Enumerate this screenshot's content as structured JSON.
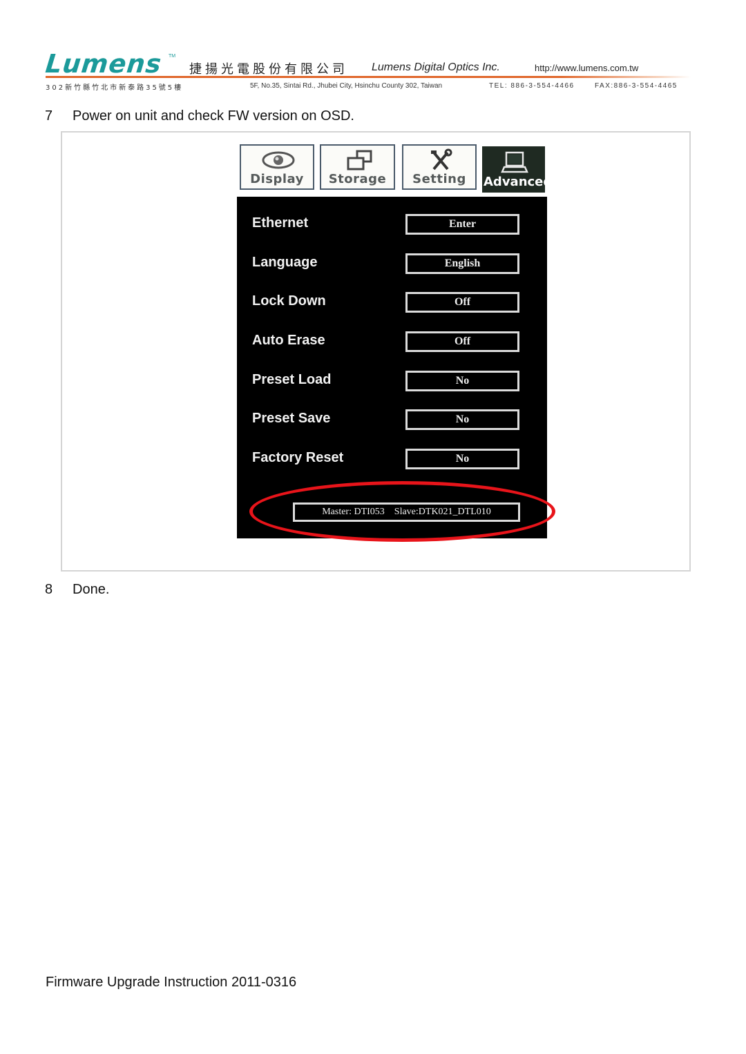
{
  "letterhead": {
    "logo_text": "Lumens",
    "trademark": "TM",
    "company_name_cn": "捷揚光電股份有限公司",
    "company_name_en": "Lumens Digital Optics Inc.",
    "website": "http://www.lumens.com.tw",
    "address_cn": "302新竹縣竹北市新泰路35號5樓",
    "address_en": "5F, No.35, Sintai Rd., Jhubei City, Hsinchu County 302, Taiwan",
    "tel": "TEL: 886-3-554-4466",
    "fax": "FAX:886-3-554-4465",
    "brand_color": "#1b9a9a",
    "rule_color": "#e0662a"
  },
  "steps": [
    {
      "number": "7",
      "text": "Power on unit and check FW version on OSD."
    },
    {
      "number": "8",
      "text": "Done."
    }
  ],
  "osd": {
    "tabs": [
      {
        "label": "Display",
        "icon": "eye-icon",
        "active": false
      },
      {
        "label": "Storage",
        "icon": "windows-icon",
        "active": false
      },
      {
        "label": "Setting",
        "icon": "tools-icon",
        "active": false
      },
      {
        "label": "Advanced",
        "icon": "computer-icon",
        "active": true
      }
    ],
    "rows": [
      {
        "label": "Ethernet",
        "value": "Enter"
      },
      {
        "label": "Language",
        "value": "English"
      },
      {
        "label": "Lock Down",
        "value": "Off"
      },
      {
        "label": "Auto Erase",
        "value": "Off"
      },
      {
        "label": "Preset Load",
        "value": "No"
      },
      {
        "label": "Preset Save",
        "value": "No"
      },
      {
        "label": "Factory Reset",
        "value": "No"
      }
    ],
    "firmware": "Master: DTI053    Slave:DTK021_DTL010",
    "highlight_color": "#e8141a"
  },
  "footer": {
    "text": "Firmware Upgrade Instruction 2011-0316"
  }
}
